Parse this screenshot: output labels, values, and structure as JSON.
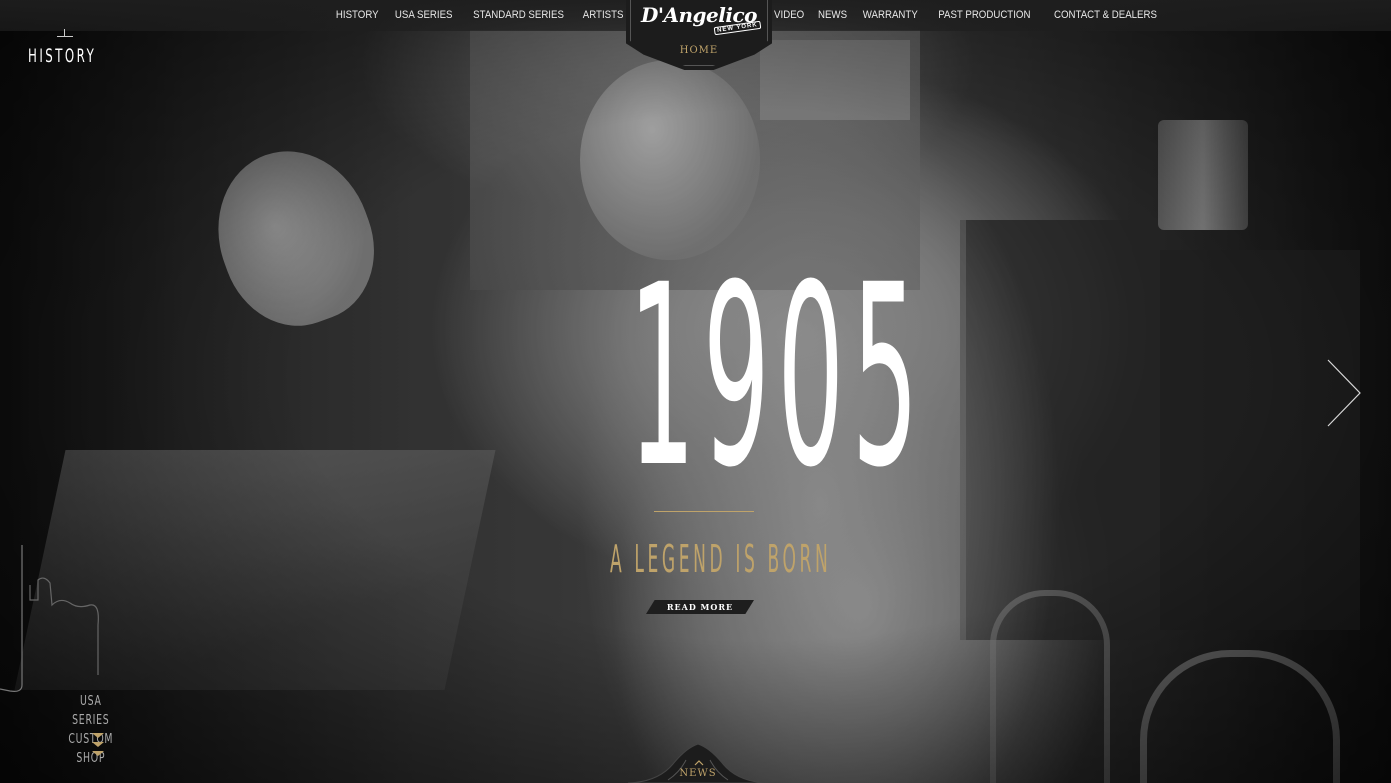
{
  "nav": {
    "left_items": [
      {
        "label": "HISTORY"
      },
      {
        "label": "USA SERIES"
      },
      {
        "label": "STANDARD SERIES"
      },
      {
        "label": "ARTISTS"
      }
    ],
    "right_items": [
      {
        "label": "VIDEO"
      },
      {
        "label": "NEWS"
      },
      {
        "label": "WARRANTY"
      },
      {
        "label": "PAST PRODUCTION"
      },
      {
        "label": "CONTACT & DEALERS"
      }
    ],
    "logo_text": "D'Angelico",
    "logo_sub": "NEW YORK",
    "home_label": "HOME"
  },
  "section_title": "HISTORY",
  "hero": {
    "year": "1905",
    "tagline": "A LEGEND IS BORN",
    "read_more": "READ MORE"
  },
  "side_teaser": {
    "line1": "USA SERIES",
    "line2": "CUSTOM SHOP"
  },
  "bottom": {
    "news_label": "NEWS"
  },
  "colors": {
    "accent_gold": "#bfa36a",
    "nav_bg": "#1e1e1e",
    "text_light": "#e8e8e8"
  },
  "icons": {
    "next": "chevron-right-icon",
    "down": "triple-chevron-down-icon",
    "up": "chevron-up-icon"
  }
}
